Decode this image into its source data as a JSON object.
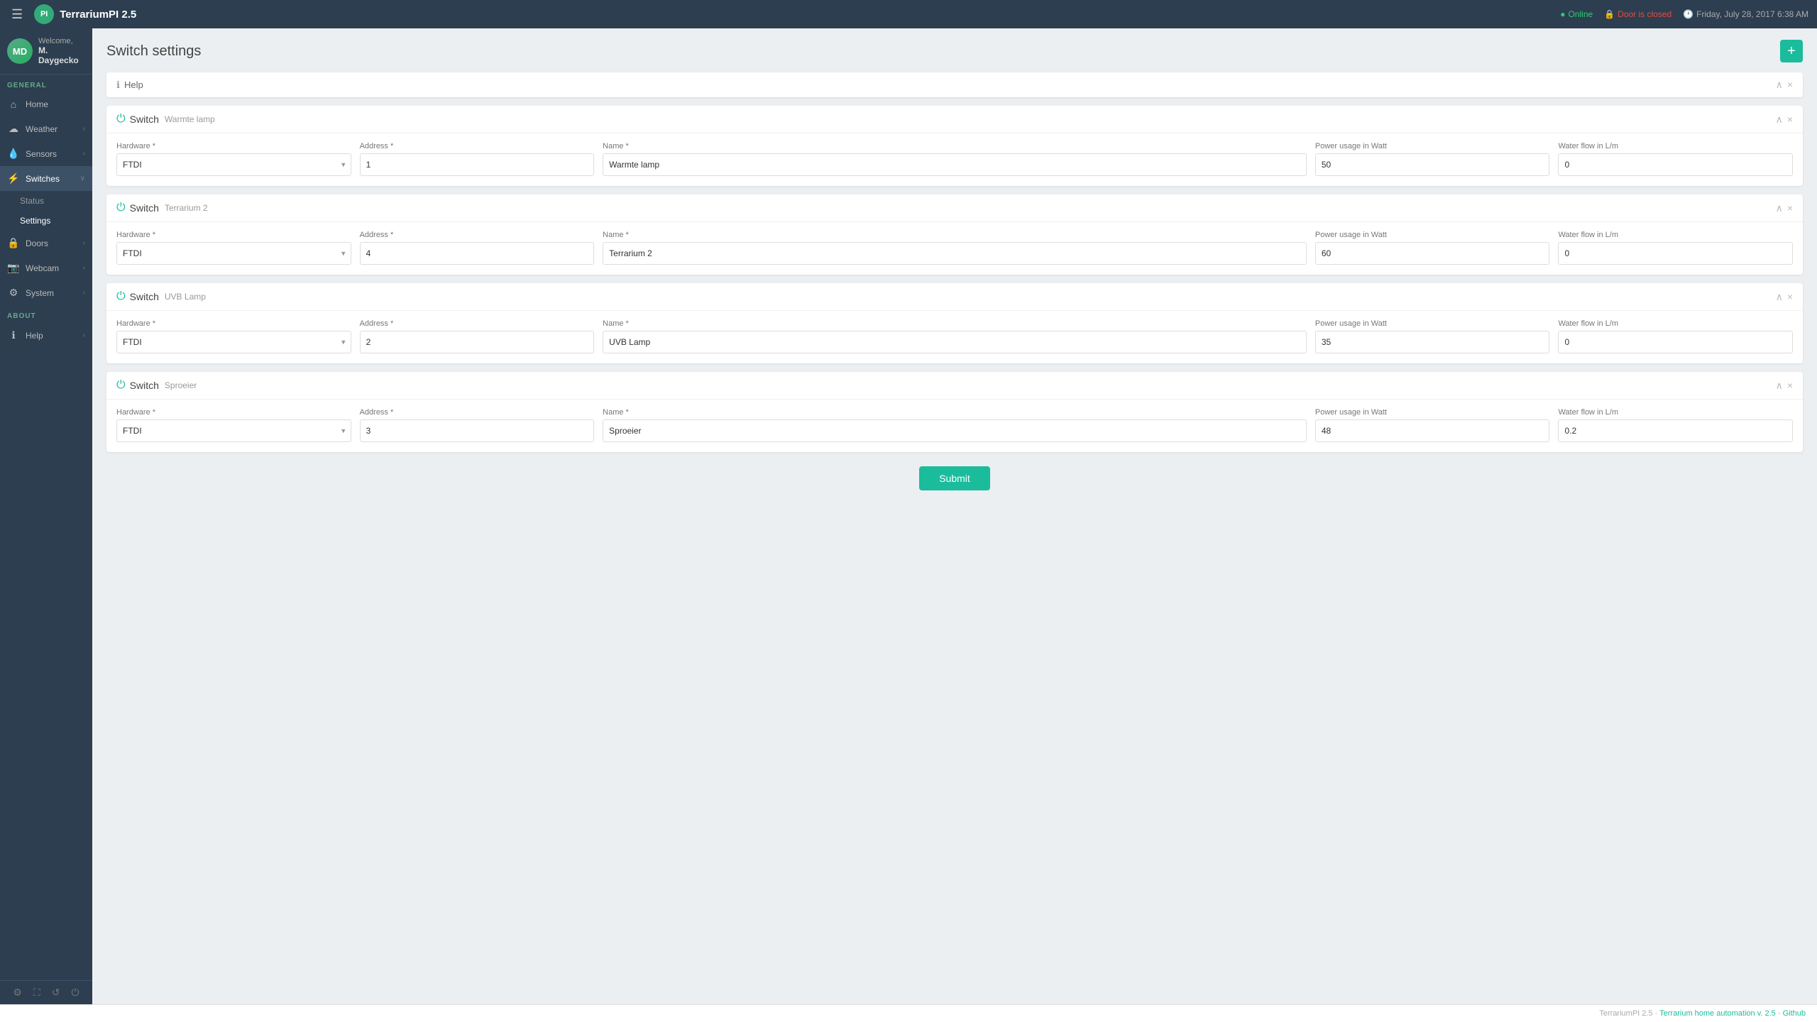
{
  "app": {
    "brand": "TerrariumPI 2.5",
    "hamburger": "☰"
  },
  "topbar": {
    "online_label": "Online",
    "door_label": "Door is closed",
    "time_label": "Friday, July 28, 2017 6:38 AM",
    "online_icon": "●",
    "door_icon": "🔒",
    "time_icon": "🕐"
  },
  "sidebar": {
    "welcome": "Welcome,",
    "user": "M. Daygecko",
    "avatar_initials": "MD",
    "general_label": "GENERAL",
    "about_label": "ABOUT",
    "items": [
      {
        "id": "home",
        "label": "Home",
        "icon": "⌂",
        "has_sub": false
      },
      {
        "id": "weather",
        "label": "Weather",
        "icon": "☁",
        "has_sub": true
      },
      {
        "id": "sensors",
        "label": "Sensors",
        "icon": "💧",
        "has_sub": true
      },
      {
        "id": "switches",
        "label": "Switches",
        "icon": "⚡",
        "has_sub": true,
        "active": true
      },
      {
        "id": "doors",
        "label": "Doors",
        "icon": "🔒",
        "has_sub": true
      },
      {
        "id": "webcam",
        "label": "Webcam",
        "icon": "📷",
        "has_sub": true
      },
      {
        "id": "system",
        "label": "System",
        "icon": "⚙",
        "has_sub": true
      }
    ],
    "switches_sub": [
      {
        "id": "status",
        "label": "Status"
      },
      {
        "id": "settings",
        "label": "Settings",
        "active": true
      }
    ],
    "about_items": [
      {
        "id": "help",
        "label": "Help",
        "icon": "ℹ",
        "has_sub": true
      }
    ],
    "footer_icons": [
      "⚙",
      "⛶",
      "↺",
      "⏻"
    ]
  },
  "page": {
    "title": "Switch settings",
    "add_button": "+"
  },
  "help_card": {
    "label": "Help",
    "chevron_up": "∧",
    "close": "×"
  },
  "switches": [
    {
      "id": 1,
      "title": "Switch",
      "name": "Warmte lamp",
      "hardware_label": "Hardware *",
      "hardware_value": "FTDI",
      "hardware_options": [
        "FTDI"
      ],
      "address_label": "Address *",
      "address_value": "1",
      "name_label": "Name *",
      "power_label": "Power usage in Watt",
      "power_value": "50",
      "water_label": "Water flow in L/m",
      "water_value": "0"
    },
    {
      "id": 2,
      "title": "Switch",
      "name": "Terrarium 2",
      "hardware_label": "Hardware *",
      "hardware_value": "FTDI",
      "hardware_options": [
        "FTDI"
      ],
      "address_label": "Address *",
      "address_value": "4",
      "name_label": "Name *",
      "power_label": "Power usage in Watt",
      "power_value": "60",
      "water_label": "Water flow in L/m",
      "water_value": "0"
    },
    {
      "id": 3,
      "title": "Switch",
      "name": "UVB Lamp",
      "hardware_label": "Hardware *",
      "hardware_value": "FTDI",
      "hardware_options": [
        "FTDI"
      ],
      "address_label": "Address *",
      "address_value": "2",
      "name_label": "Name *",
      "power_label": "Power usage in Watt",
      "power_value": "35",
      "water_label": "Water flow in L/m",
      "water_value": "0"
    },
    {
      "id": 4,
      "title": "Switch",
      "name": "Sproeier",
      "hardware_label": "Hardware *",
      "hardware_value": "FTDI",
      "hardware_options": [
        "FTDI"
      ],
      "address_label": "Address *",
      "address_value": "3",
      "name_label": "Name *",
      "power_label": "Power usage in Watt",
      "power_value": "48",
      "water_label": "Water flow in L/m",
      "water_value": "0.2"
    }
  ],
  "submit": {
    "label": "Submit"
  },
  "footer": {
    "text": "TerrariumPI 2.5 · Terrarium home automation v. 2.5 · Github"
  }
}
